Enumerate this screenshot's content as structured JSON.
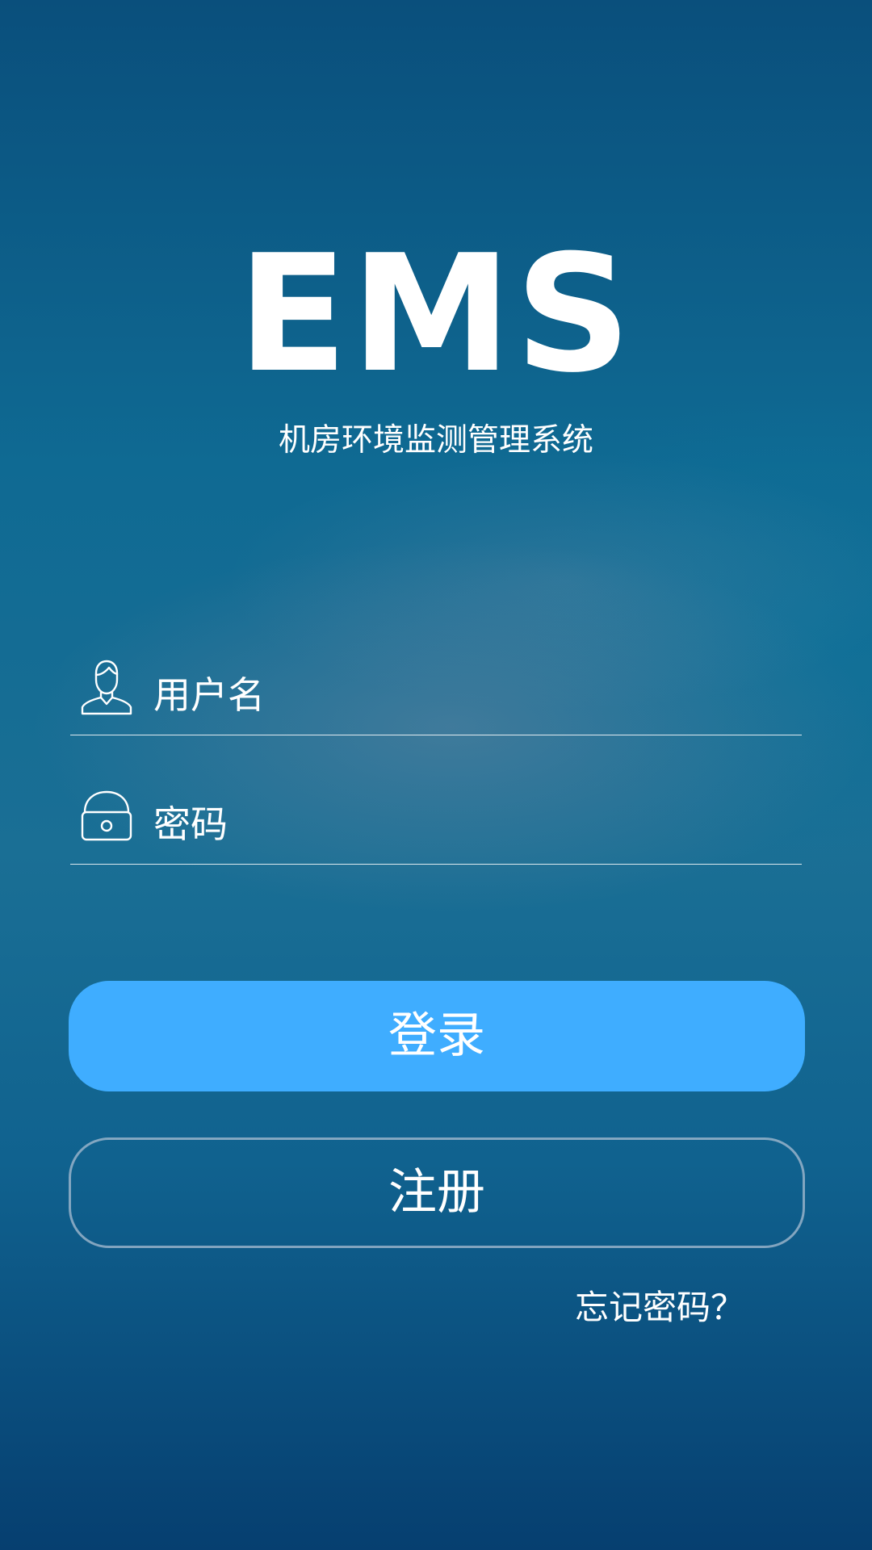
{
  "app": {
    "title": "EMS",
    "subtitle": "机房环境监测管理系统"
  },
  "login_form": {
    "username": {
      "placeholder": "用户名",
      "value": "",
      "icon": "user-icon"
    },
    "password": {
      "placeholder": "密码",
      "value": "",
      "icon": "lock-icon"
    },
    "login_label": "登录",
    "register_label": "注册",
    "forgot_password_label": "忘记密码？"
  },
  "colors": {
    "background_top": "#0a4f7c",
    "background_bottom": "#063f70",
    "primary_button": "#3fadff",
    "text": "#ffffff"
  }
}
